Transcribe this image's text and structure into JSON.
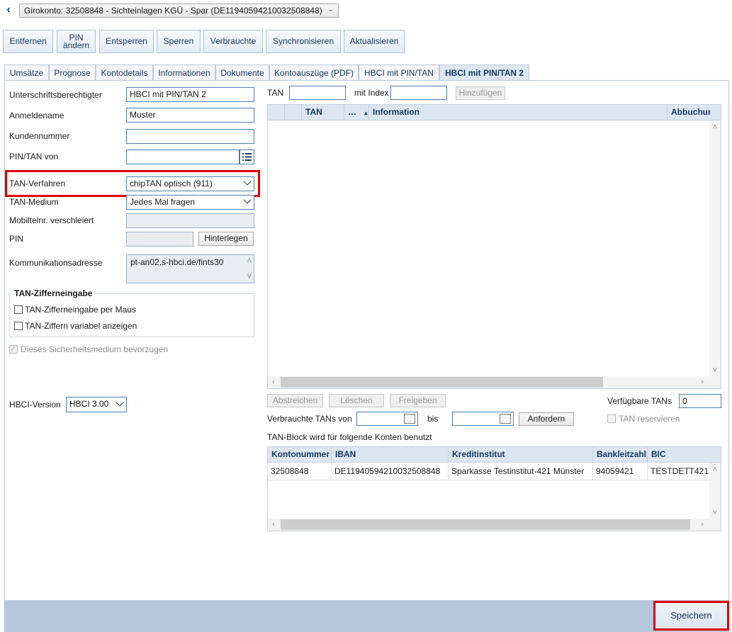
{
  "header": {
    "back_glyph": "‹",
    "account_select": "Girokonto: 32508848 - Sichteinlagen KGÜ - Spar (DE11940594210032508848)"
  },
  "toolbar": {
    "buttons": [
      "Entfernen",
      "PIN\nändern",
      "Entsperren",
      "Sperren",
      "Verbrauchte",
      "Synchronisieren",
      "Aktualisieren"
    ]
  },
  "tabs": [
    "Umsätze",
    "Prognose",
    "Kontodetails",
    "Informationen",
    "Dokumente",
    "Kontoauszüge (PDF)",
    "HBCI mit PIN/TAN",
    "HBCI mit PIN/TAN 2"
  ],
  "active_tab": "HBCI mit PIN/TAN 2",
  "form": {
    "unterschrift_label": "Unterschriftsberechtigter",
    "unterschrift_value": "HBCI mit PIN/TAN 2",
    "anmeldename_label": "Anmeldename",
    "anmeldename_value": "Muster",
    "kundennummer_label": "Kundennummer",
    "kundennummer_value": "",
    "pintan_von_label": "PIN/TAN von",
    "pintan_von_value": "",
    "tan_verfahren_label": "TAN-Verfahren",
    "tan_verfahren_value": "chipTAN optisch (911)",
    "tan_medium_label": "TAN-Medium",
    "tan_medium_value": "Jedes Mal fragen",
    "mobil_label": "Mobiltelnr. verschleiert",
    "mobil_value": "",
    "pin_label": "PIN",
    "pin_value": "",
    "hinterlegen_label": "Hinterlegen",
    "komm_label": "Kommunikationsadresse",
    "komm_value": "pt-an02.s-hbci.de/fints30",
    "tan_ziffer_group_title": "TAN-Zifferneingabe",
    "cb_maus_label": "TAN-Zifferneingabe per Maus",
    "cb_variabel_label": "TAN-Ziffern variabel anzeigen",
    "cb_bevorzugen_label": "Dieses Sicherheitsmedium bevorzugen",
    "hbci_version_label": "HBCI-Version",
    "hbci_version_value": "HBCI 3.00"
  },
  "tan_panel": {
    "tan_label": "TAN",
    "tan_value": "",
    "index_label": "mit Index",
    "index_value": "",
    "add_label": "Hinzufügen",
    "columns": [
      "TAN",
      "…",
      "Information",
      "Abbuchur"
    ],
    "sort_indicator": "▲",
    "actions": [
      "Abstreichen",
      "Löschen",
      "Freigeben"
    ],
    "verfuegbar_label": "Verfügbare TANs",
    "verfuegbar_value": "0",
    "verbraucht_von_label": "Verbrauchte TANs von",
    "bis_label": "bis",
    "anfordern_label": "Anfordern",
    "reservieren_label": "TAN reservieren",
    "tan_block_label": "TAN-Block wird für folgende Konten benutzt"
  },
  "konten_table": {
    "columns": [
      "Kontonummer",
      "IBAN",
      "Kreditinstitut",
      "Bankleitzahl",
      "BIC"
    ],
    "rows": [
      [
        "32508848",
        "DE11940594210032508848",
        "Sparkasse Testinstitut-421 Münster",
        "94059421",
        "TESTDETT421"
      ]
    ]
  },
  "footer": {
    "save_label": "Speichern"
  },
  "colors": {
    "accent_text": "#17375e",
    "header_bg": "#dce6f1",
    "footer_bg": "#b7c8dc",
    "highlight_border": "#e00000"
  }
}
